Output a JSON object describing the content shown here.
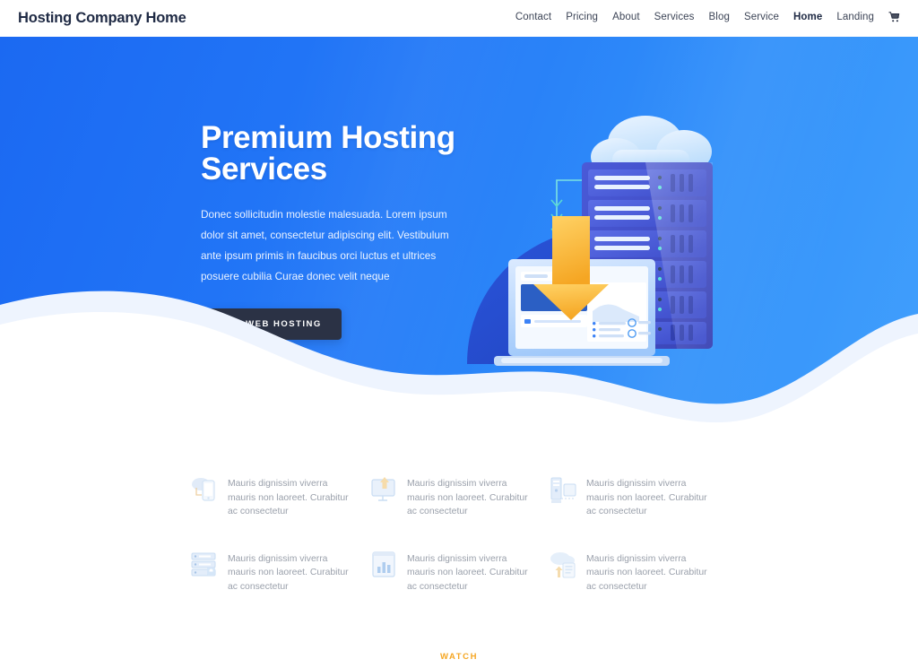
{
  "header": {
    "brand": "Hosting Company Home",
    "nav": [
      {
        "label": "Contact",
        "active": false
      },
      {
        "label": "Pricing",
        "active": false
      },
      {
        "label": "About",
        "active": false
      },
      {
        "label": "Services",
        "active": false
      },
      {
        "label": "Blog",
        "active": false
      },
      {
        "label": "Service",
        "active": false
      },
      {
        "label": "Home",
        "active": true
      },
      {
        "label": "Landing",
        "active": false
      }
    ],
    "cart_icon": "shopping-cart-icon"
  },
  "hero": {
    "title": "Premium Hosting Services",
    "subtitle": "Donec sollicitudin molestie malesuada. Lorem ipsum dolor sit amet, consectetur adipiscing elit. Vestibulum ante ipsum primis in faucibus orci luctus et ultrices posuere cubilia Curae donec velit neque",
    "cta_label": "Get Web Hosting",
    "illustration": "cloud-server-laptop-download-illustration",
    "gradient_from": "#1b69f2",
    "gradient_to": "#42a0fc",
    "cta_bg": "#2b3245"
  },
  "features": [
    {
      "icon": "cloud-mobile-icon",
      "text": "Mauris dignissim viverra mauris non laoreet. Curabitur ac consectetur"
    },
    {
      "icon": "monitor-upload-icon",
      "text": "Mauris dignissim viverra mauris non laoreet. Curabitur ac consectetur"
    },
    {
      "icon": "server-tower-icon",
      "text": "Mauris dignissim viverra mauris non laoreet. Curabitur ac consectetur"
    },
    {
      "icon": "server-rack-lock-icon",
      "text": "Mauris dignissim viverra mauris non laoreet. Curabitur ac consectetur"
    },
    {
      "icon": "analytics-chart-icon",
      "text": "Mauris dignissim viverra mauris non laoreet. Curabitur ac consectetur"
    },
    {
      "icon": "cloud-document-upload-icon",
      "text": "Mauris dignissim viverra mauris non laoreet. Curabitur ac consectetur"
    }
  ],
  "watch": {
    "label": "Watch",
    "color": "#f5a623"
  }
}
